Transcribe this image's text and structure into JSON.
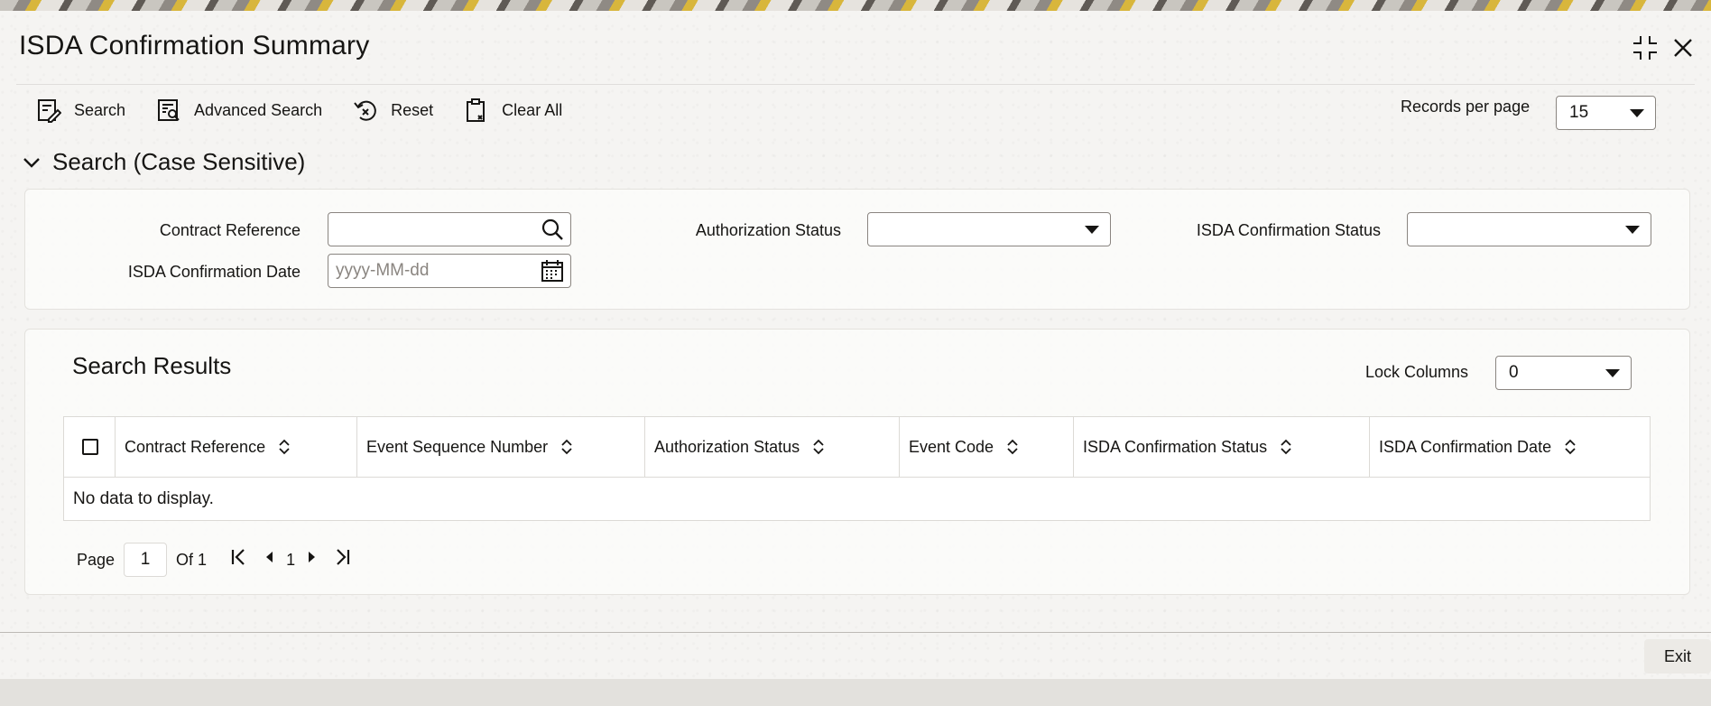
{
  "header": {
    "title": "ISDA Confirmation Summary"
  },
  "toolbar": {
    "search_label": "Search",
    "advanced_search_label": "Advanced Search",
    "reset_label": "Reset",
    "clear_all_label": "Clear All",
    "records_per_page_label": "Records per page",
    "records_per_page_value": "15"
  },
  "search_section": {
    "title": "Search (Case Sensitive)",
    "contract_reference_label": "Contract Reference",
    "contract_reference_value": "",
    "authorization_status_label": "Authorization Status",
    "authorization_status_value": "",
    "isda_confirmation_status_label": "ISDA Confirmation Status",
    "isda_confirmation_status_value": "",
    "isda_confirmation_date_label": "ISDA Confirmation Date",
    "isda_confirmation_date_placeholder": "yyyy-MM-dd"
  },
  "results": {
    "title": "Search Results",
    "lock_columns_label": "Lock Columns",
    "lock_columns_value": "0",
    "columns": [
      "Contract Reference",
      "Event Sequence Number",
      "Authorization Status",
      "Event Code",
      "ISDA Confirmation Status",
      "ISDA Confirmation Date"
    ],
    "empty_message": "No data to display."
  },
  "pagination": {
    "page_label": "Page",
    "page_value": "1",
    "of_label": "Of 1",
    "current_page": "1"
  },
  "footer": {
    "exit_label": "Exit"
  }
}
